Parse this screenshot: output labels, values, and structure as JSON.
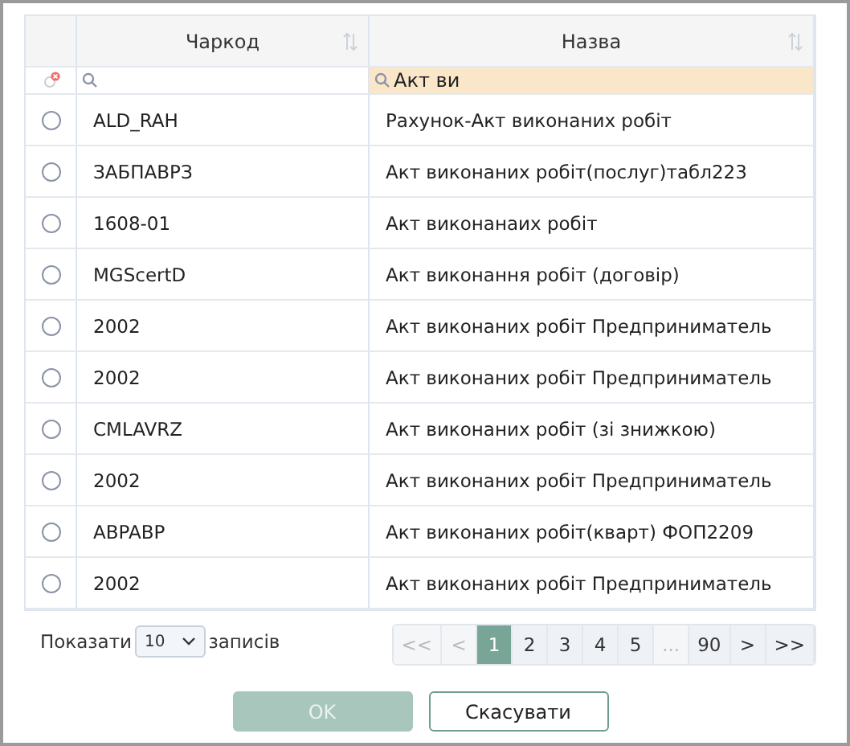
{
  "table": {
    "columns": [
      {
        "label": "Чаркод"
      },
      {
        "label": "Назва",
        "filter": "Акт ви"
      }
    ],
    "rows": [
      {
        "code": "ALD_RAH",
        "name": "Рахунок-Акт виконаних робіт",
        "selected": false
      },
      {
        "code": "ЗАБПАВРЗ",
        "name": "Акт виконаних робіт(послуг)табл223",
        "selected": false
      },
      {
        "code": "1608-01",
        "name": "Акт виконанаих робіт",
        "selected": false
      },
      {
        "code": "MGScertD",
        "name": "Акт виконання робіт (договір)",
        "selected": false
      },
      {
        "code": "2002",
        "name": "Акт виконаних робіт Предприниматель",
        "selected": false
      },
      {
        "code": "2002",
        "name": "Акт виконаних робіт Предприниматель",
        "selected": false
      },
      {
        "code": "CMLAVRZ",
        "name": "Акт виконаних робіт (зі знижкою)",
        "selected": false
      },
      {
        "code": "2002",
        "name": "Акт виконаних робіт Предприниматель",
        "selected": false
      },
      {
        "code": "ABPABP",
        "name": "Акт виконаних робіт(кварт) ФОП2209",
        "selected": false
      },
      {
        "code": "2002",
        "name": "Акт виконаних робіт Предприниматель",
        "selected": false
      }
    ]
  },
  "page_size": {
    "prefix": "Показати",
    "value": "10",
    "suffix": "записів"
  },
  "pagination": [
    {
      "label": "<<",
      "selected": false,
      "disabled": true
    },
    {
      "label": "<",
      "selected": false,
      "disabled": true
    },
    {
      "label": "1",
      "selected": true,
      "disabled": false
    },
    {
      "label": "2",
      "selected": false,
      "disabled": false
    },
    {
      "label": "3",
      "selected": false,
      "disabled": false
    },
    {
      "label": "4",
      "selected": false,
      "disabled": false
    },
    {
      "label": "5",
      "selected": false,
      "disabled": false
    },
    {
      "label": "...",
      "selected": false,
      "disabled": true
    },
    {
      "label": "90",
      "selected": false,
      "disabled": false
    },
    {
      "label": ">",
      "selected": false,
      "disabled": false
    },
    {
      "label": ">>",
      "selected": false,
      "disabled": false
    }
  ],
  "buttons": [
    {
      "label": "OK",
      "disabled": true
    },
    {
      "label": "Скасувати",
      "disabled": false
    }
  ]
}
